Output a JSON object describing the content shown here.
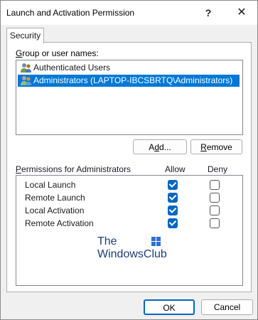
{
  "window": {
    "title": "Launch and Activation Permission",
    "help_glyph": "?",
    "close_glyph": "✕"
  },
  "tabs": [
    "Security"
  ],
  "group_section": {
    "label_underlined": "G",
    "label_rest": "roup or user names:",
    "users": [
      {
        "name": "Authenticated Users",
        "selected": false,
        "icon": "users-group-icon"
      },
      {
        "name": "Administrators (LAPTOP-IBCSBRTQ\\Administrators)",
        "selected": true,
        "icon": "users-group-icon"
      }
    ],
    "add_button": {
      "pre": "A",
      "underlined": "d",
      "post": "d..."
    },
    "remove_button": {
      "pre": "",
      "underlined": "R",
      "post": "emove"
    }
  },
  "permissions": {
    "header_underlined": "P",
    "header_rest": "ermissions for Administrators",
    "allow_label": "Allow",
    "deny_label": "Deny",
    "rows": [
      {
        "name": "Local Launch",
        "allow": true,
        "deny": false
      },
      {
        "name": "Remote Launch",
        "allow": true,
        "deny": false
      },
      {
        "name": "Local Activation",
        "allow": true,
        "deny": false
      },
      {
        "name": "Remote Activation",
        "allow": true,
        "deny": false
      }
    ]
  },
  "watermark": {
    "line1": "The",
    "line2": "WindowsClub"
  },
  "footer": {
    "ok_label": "OK",
    "cancel_label": "Cancel"
  },
  "colors": {
    "accent": "#0078d7",
    "checkbox": "#0067c0",
    "watermark": "#1c3f72"
  }
}
